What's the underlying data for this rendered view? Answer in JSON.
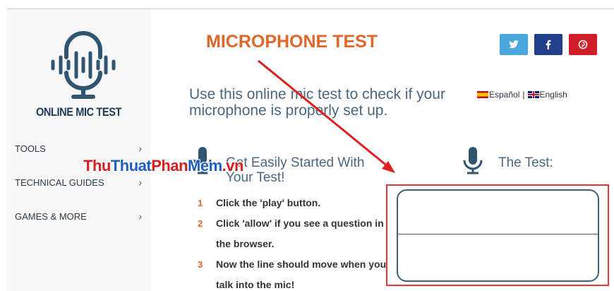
{
  "sidebar": {
    "logo_text": "ONLINE MIC TEST",
    "items": [
      {
        "label": "TOOLS",
        "chevron": "›"
      },
      {
        "label": "TECHNICAL GUIDES",
        "chevron": "›"
      },
      {
        "label": "GAMES & MORE",
        "chevron": "›"
      }
    ]
  },
  "watermark": {
    "part1": "Thu",
    "part2": "Thuat",
    "part3": "Phan",
    "part4": "Mem",
    "part5": ".vn"
  },
  "header": {
    "title": "MICROPHONE TEST"
  },
  "social": {
    "icons": [
      "twitter-icon",
      "facebook-icon",
      "pinterest-icon"
    ]
  },
  "intro": "Use this online mic test to check if your microphone is properly set up.",
  "languages": {
    "es": "Español",
    "separator": "|",
    "en": "English"
  },
  "started": {
    "heading": "Get Easily Started With Your Test!",
    "steps": [
      {
        "num": "1",
        "text": "Click the 'play' button."
      },
      {
        "num": "2",
        "text": "Click 'allow' if you see a question in the browser."
      },
      {
        "num": "3",
        "text": "Now the line should move when you talk into the mic!"
      }
    ]
  },
  "test": {
    "heading": "The Test:"
  },
  "colors": {
    "accent": "#e4652a",
    "heading_text": "#4b6780",
    "highlight_box": "#e23a3a",
    "arrow": "#e02020"
  }
}
